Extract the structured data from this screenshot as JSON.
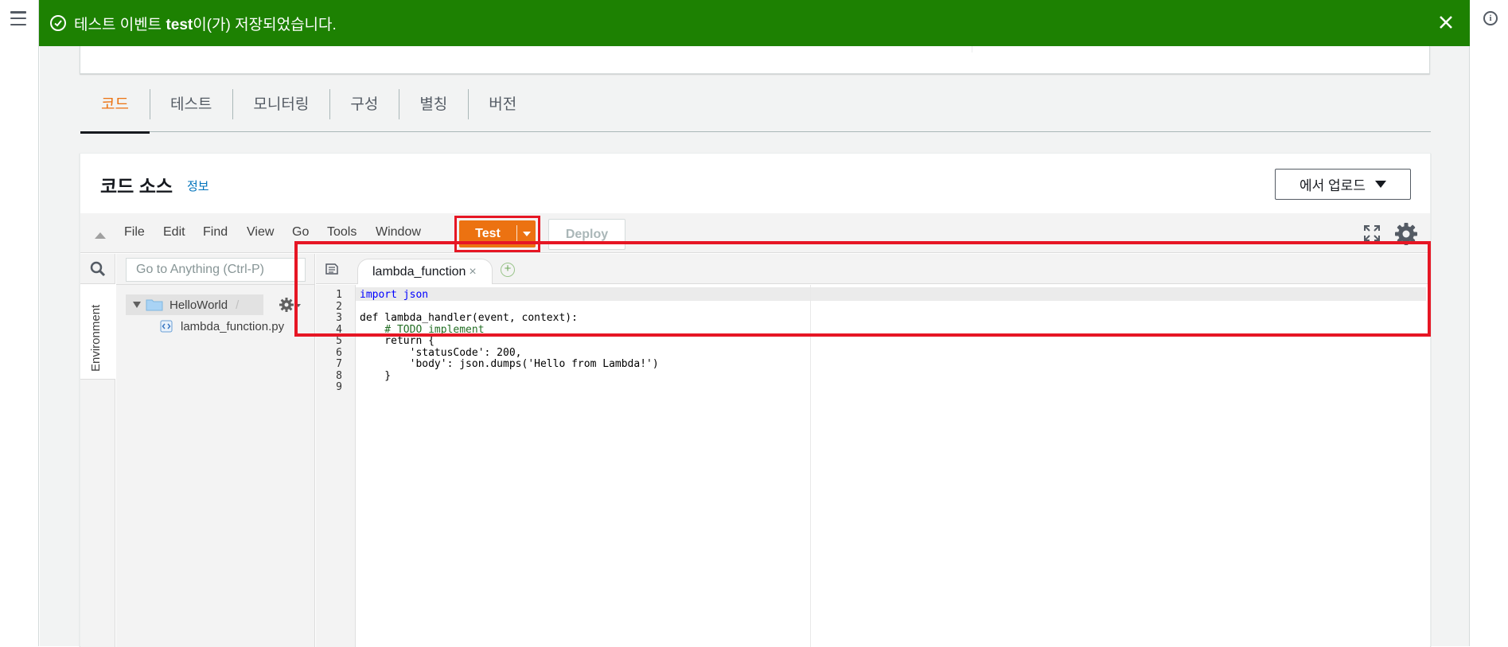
{
  "flash": {
    "prefix": "테스트 이벤트 ",
    "event_name": "test",
    "suffix": "이(가) 저장되었습니다."
  },
  "tabs": [
    "코드",
    "테스트",
    "모니터링",
    "구성",
    "별칭",
    "버전"
  ],
  "code_source": {
    "title": "코드 소스",
    "info_link": "정보",
    "upload_button": "에서 업로드"
  },
  "ide": {
    "menu": [
      "File",
      "Edit",
      "Find",
      "View",
      "Go",
      "Tools",
      "Window"
    ],
    "test_button": "Test",
    "deploy_button": "Deploy",
    "goto_placeholder": "Go to Anything (Ctrl-P)",
    "environment_tab": "Environment",
    "tree": {
      "folder": "HelloWorld",
      "folder_suffix": "/",
      "file": "lambda_function.py"
    },
    "open_tab": "lambda_function",
    "line_numbers": [
      "1",
      "2",
      "3",
      "4",
      "5",
      "6",
      "7",
      "8",
      "9"
    ],
    "code_lines": [
      "import json",
      "",
      "def lambda_handler(event, context):",
      "    # TODO implement",
      "    return {",
      "        'statusCode': 200,",
      "        'body': json.dumps('Hello from Lambda!')",
      "    }",
      ""
    ]
  },
  "colors": {
    "flash_bg": "#1d8102",
    "accent_orange": "#ec7211",
    "highlight_red": "#e61624"
  }
}
